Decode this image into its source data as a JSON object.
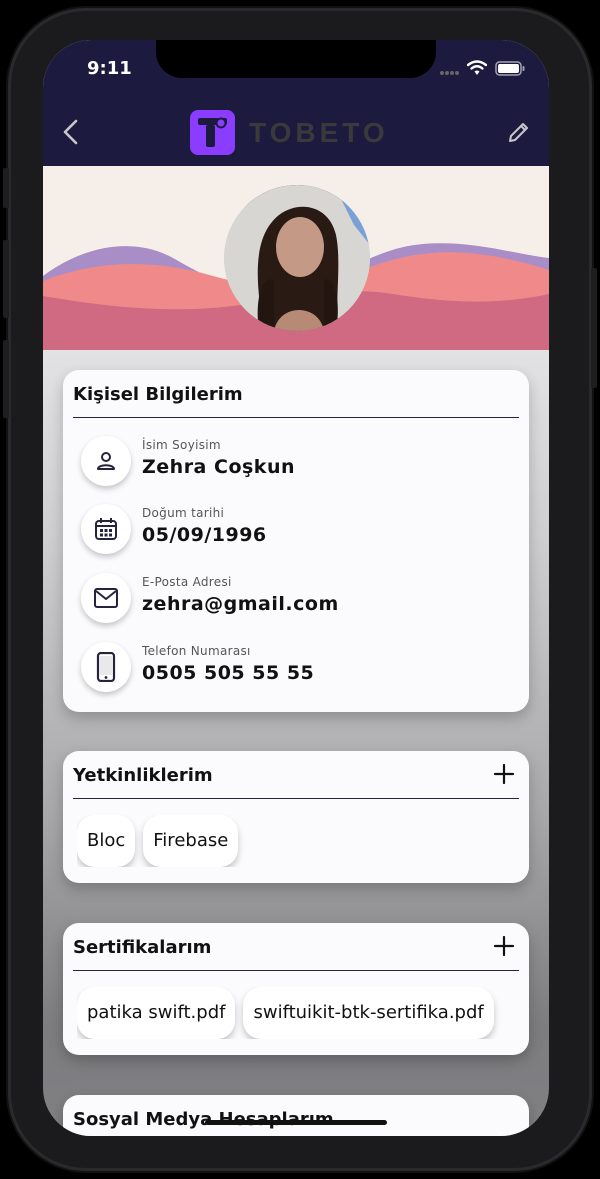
{
  "status_bar": {
    "time": "9:11"
  },
  "app_bar": {
    "logo_text": "TOBETO"
  },
  "personal": {
    "title": "Kişisel Bilgilerim",
    "rows": [
      {
        "label": "İsim Soyisim",
        "value": "Zehra Coşkun",
        "icon": "person-icon"
      },
      {
        "label": "Doğum tarihi",
        "value": "05/09/1996",
        "icon": "calendar-icon"
      },
      {
        "label": "E-Posta Adresi",
        "value": "zehra@gmail.com",
        "icon": "mail-icon"
      },
      {
        "label": "Telefon Numarası",
        "value": "0505 505 55 55",
        "icon": "phone-icon"
      }
    ]
  },
  "skills": {
    "title": "Yetkinliklerim",
    "items": [
      "Bloc",
      "Firebase"
    ]
  },
  "certificates": {
    "title": "Sertifikalarım",
    "items": [
      "patika swift.pdf",
      "swiftuikit-btk-sertifika.pdf"
    ]
  },
  "social": {
    "title": "Sosyal Medya Hesaplarım"
  },
  "colors": {
    "app_bar": "#1c1a3f",
    "logo_accent": "#8b3dff",
    "wave_pink": "#d06a82",
    "wave_coral": "#f08a8a",
    "wave_purple": "#9b7bc0"
  }
}
